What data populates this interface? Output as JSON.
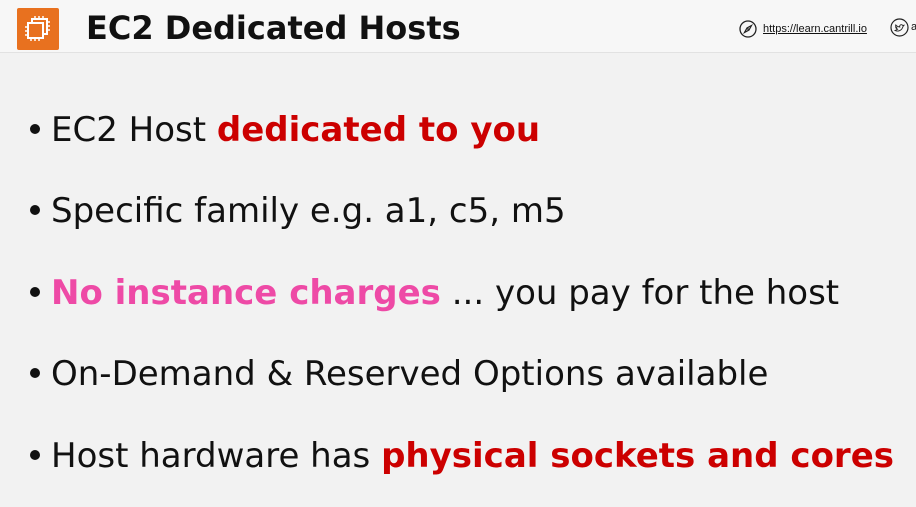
{
  "header": {
    "title": "EC2 Dedicated Hosts",
    "url": "https://learn.cantrill.io",
    "handle_stub": "a",
    "logo_icon": "ec2-instance-icon",
    "logo_color": "#e8711f"
  },
  "bullets": [
    {
      "parts": [
        {
          "text": "EC2 Host "
        },
        {
          "text": "dedicated to you",
          "style": "red"
        }
      ]
    },
    {
      "parts": [
        {
          "text": "Specific family e.g. a1, c5, m5"
        }
      ]
    },
    {
      "parts": [
        {
          "text": "No instance charges",
          "style": "pink"
        },
        {
          "text": " ... you pay for the host"
        }
      ]
    },
    {
      "parts": [
        {
          "text": "On-Demand & Reserved Options available"
        }
      ]
    },
    {
      "parts": [
        {
          "text": "Host hardware has "
        },
        {
          "text": "physical sockets and cores",
          "style": "red"
        }
      ]
    }
  ],
  "colors": {
    "emphasis_red": "#cc0000",
    "emphasis_pink": "#ee4aa6",
    "background": "#f2f2f2"
  }
}
